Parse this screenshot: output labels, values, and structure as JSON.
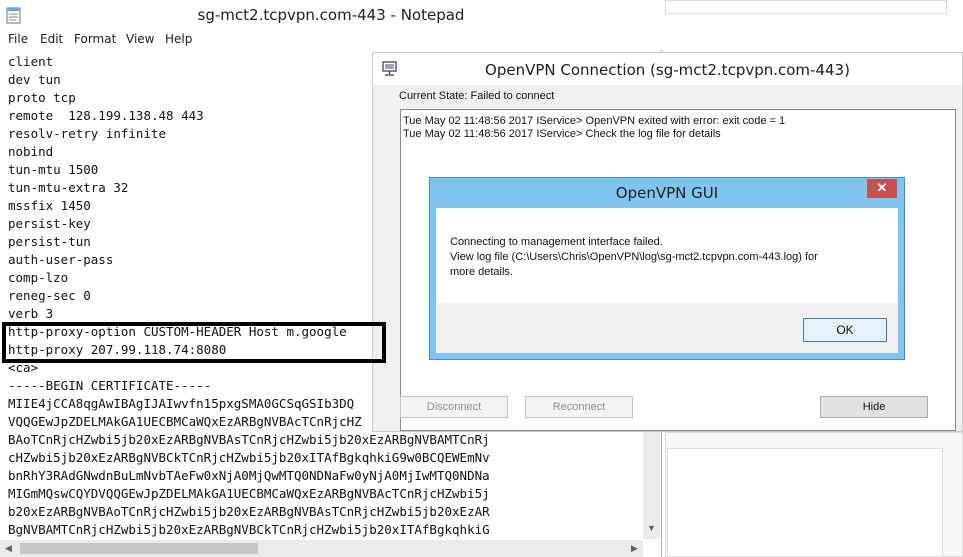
{
  "notepad": {
    "title": "sg-mct2.tcpvpn.com-443 - Notepad",
    "menu": [
      "File",
      "Edit",
      "Format",
      "View",
      "Help"
    ],
    "lines": [
      "client",
      "dev tun",
      "proto tcp",
      "remote  128.199.138.48 443",
      "resolv-retry infinite",
      "nobind",
      "tun-mtu 1500",
      "tun-mtu-extra 32",
      "mssfix 1450",
      "persist-key",
      "persist-tun",
      "auth-user-pass",
      "comp-lzo",
      "reneg-sec 0",
      "verb 3",
      "http-proxy-option CUSTOM-HEADER Host m.google",
      "http-proxy 207.99.118.74:8080",
      "<ca>",
      "-----BEGIN CERTIFICATE-----",
      "MIIE4jCCA8qgAwIBAgIJAIwvfn15pxgSMA0GCSqGSIb3DQ",
      "VQQGEwJpZDELMAkGA1UECBMCaWQxEzARBgNVBAcTCnRjcHZ",
      "BAoTCnRjcHZwbi5jb20xEzARBgNVBAsTCnRjcHZwbi5jb20xEzARBgNVBAMTCnRj",
      "cHZwbi5jb20xEzARBgNVBCkTCnRjcHZwbi5jb20xITAfBgkqhkiG9w0BCQEWEmNv",
      "bnRhY3RAdGNwdnBuLmNvbTAeFw0xNjA0MjQwMTQ0NDNaFw0yNjA0MjIwMTQ0NDNa",
      "MIGmMQswCQYDVQQGEwJpZDELMAkGA1UECBMCaWQxEzARBgNVBAcTCnRjcHZwbi5j",
      "b20xEzARBgNVBAoTCnRjcHZwbi5jb20xEzARBgNVBAsTCnRjcHZwbi5jb20xEzAR",
      "BgNVBAMTCnRjcHZwbi5jb20xEzARBgNVBCkTCnRjcHZwbi5jb20xITAfBgkqhkiG"
    ]
  },
  "ovpn": {
    "title": "OpenVPN Connection (sg-mct2.tcpvpn.com-443)",
    "state": "Current State: Failed to connect",
    "log": [
      "Tue May 02 11:48:56 2017 IService> OpenVPN exited with error: exit code = 1",
      "Tue May 02 11:48:56 2017 IService> Check the log file for details"
    ],
    "disconnect_label": "Disconnect",
    "reconnect_label": "Reconnect",
    "hide_label": "Hide"
  },
  "gui": {
    "title": "OpenVPN GUI",
    "close_glyph": "✕",
    "line1": "Connecting to management interface failed.",
    "line2": "View log file (C:\\Users\\Chris\\OpenVPN\\log\\sg-mct2.tcpvpn.com-443.log) for",
    "line3": "more details.",
    "ok_label": "OK"
  },
  "colors": {
    "dialog_frame": "#7fc5f0",
    "close_button": "#c75050",
    "highlight_box": "#000000"
  }
}
